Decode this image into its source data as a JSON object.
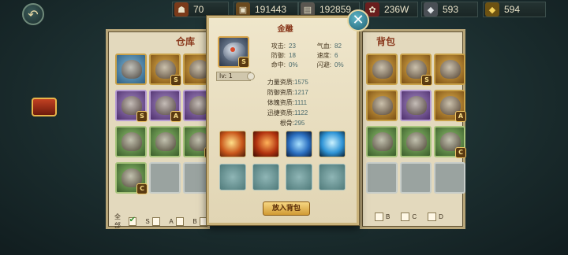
{
  "resources": [
    {
      "name": "res-1",
      "icon": "figure-icon",
      "value": "70",
      "color": "#c76a3a"
    },
    {
      "name": "res-2",
      "icon": "bag-icon",
      "value": "191443",
      "color": "#b48a4a"
    },
    {
      "name": "res-3",
      "icon": "books-icon",
      "value": "192859",
      "color": "#b5b0a6"
    },
    {
      "name": "res-4",
      "icon": "flower-icon",
      "value": "236W",
      "color": "#b23a3a"
    },
    {
      "name": "res-5",
      "icon": "silver-ingot-icon",
      "value": "593",
      "color": "#cfd2d6"
    },
    {
      "name": "res-6",
      "icon": "gold-ingot-icon",
      "value": "594",
      "color": "#e2b93e"
    }
  ],
  "warehouse": {
    "title": "仓库",
    "filters": [
      "全部",
      "S",
      "A",
      "B"
    ]
  },
  "bag": {
    "title": "背包",
    "filters": [
      "B",
      "C",
      "D"
    ]
  },
  "detail": {
    "name": "金雕",
    "grade": "S",
    "level_label": "lv: 1",
    "stats": [
      {
        "label": "攻击:",
        "value": "23",
        "label2": "气血:",
        "value2": "82"
      },
      {
        "label": "防御:",
        "value": "18",
        "label2": "速度:",
        "value2": "6"
      },
      {
        "label": "命中:",
        "value": "0%",
        "label2": "闪避:",
        "value2": "0%"
      }
    ],
    "aptitudes": [
      {
        "label": "力量资质:",
        "value": "1575"
      },
      {
        "label": "防御资质:",
        "value": "1217"
      },
      {
        "label": "体魄资质:",
        "value": "1111"
      },
      {
        "label": "迅捷资质:",
        "value": "1122"
      },
      {
        "label": "根骨:",
        "value": "295"
      }
    ],
    "add_button": "放入背包"
  },
  "grades": {
    "left": [
      "",
      "S",
      "",
      "S",
      "A",
      "",
      "",
      "",
      "A",
      "C",
      "",
      ""
    ],
    "right": [
      "",
      "S",
      "",
      "",
      "",
      "A",
      "",
      "",
      "C",
      "",
      "",
      ""
    ]
  },
  "filter_labels": {
    "all": "全部",
    "s": "S",
    "a": "A",
    "b": "B",
    "c": "C",
    "d": "D"
  }
}
